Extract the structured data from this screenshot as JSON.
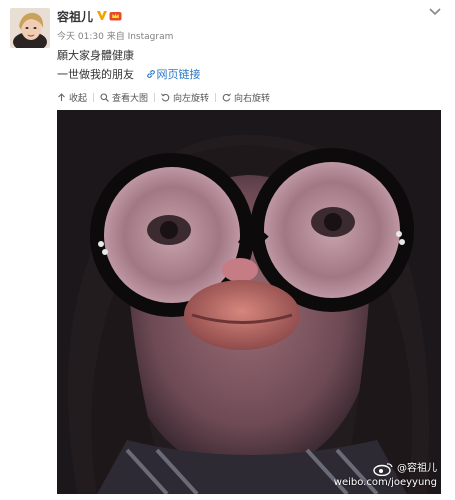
{
  "post": {
    "author": "容祖儿",
    "timestamp": "今天 01:30",
    "via_label": "来自",
    "source": "Instagram",
    "text_line1": "願大家身體健康",
    "text_line2": "一世做我的朋友",
    "link_label": "网页链接"
  },
  "toolbar": {
    "collapse": "收起",
    "view_large": "查看大图",
    "rotate_left": "向左旋转",
    "rotate_right": "向右旋转"
  },
  "watermark": {
    "handle": "@容祖儿",
    "url": "weibo.com/joeyyung"
  },
  "icons": {
    "verified": "verified-v-icon",
    "vip": "vip-crown-icon",
    "menu": "chevron-down-icon",
    "link": "link-icon",
    "collapse": "arrow-up-icon",
    "view_large": "magnify-icon",
    "rotate_left": "rotate-left-icon",
    "rotate_right": "rotate-right-icon"
  },
  "colors": {
    "link": "#2a78c8",
    "verified": "#f4a300",
    "vip": "#e64b2e"
  }
}
